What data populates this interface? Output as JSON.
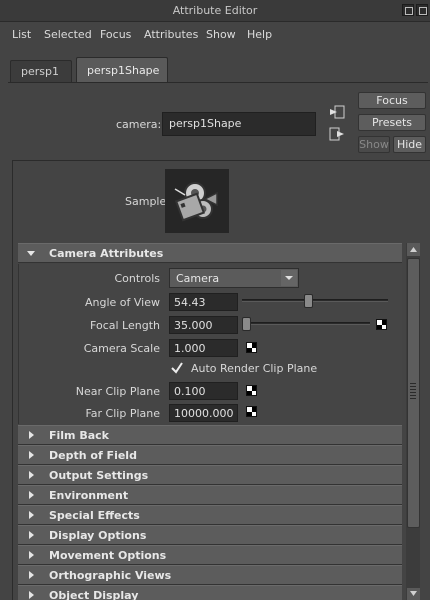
{
  "window": {
    "title": "Attribute Editor"
  },
  "menu": [
    "List",
    "Selected",
    "Focus",
    "Attributes",
    "Show",
    "Help"
  ],
  "tabs": [
    "persp1",
    "persp1Shape"
  ],
  "node": {
    "label": "camera:",
    "value": "persp1Shape"
  },
  "panel_buttons": {
    "focus": "Focus",
    "presets": "Presets",
    "show": "Show",
    "hide": "Hide"
  },
  "sample": {
    "label": "Sample"
  },
  "camera_attributes": {
    "header": "Camera Attributes",
    "controls": {
      "label": "Controls",
      "value": "Camera"
    },
    "angle_of_view": {
      "label": "Angle of View",
      "value": "54.43",
      "slider": 0.45
    },
    "focal_length": {
      "label": "Focal Length",
      "value": "35.000",
      "slider": 0.0
    },
    "camera_scale": {
      "label": "Camera Scale",
      "value": "1.000"
    },
    "auto_render_clip": {
      "label": "Auto Render Clip Plane",
      "checked": true
    },
    "near_clip": {
      "label": "Near Clip Plane",
      "value": "0.100"
    },
    "far_clip": {
      "label": "Far Clip Plane",
      "value": "10000.000"
    }
  },
  "collapsed_sections": [
    "Film Back",
    "Depth of Field",
    "Output Settings",
    "Environment",
    "Special Effects",
    "Display Options",
    "Movement Options",
    "Orthographic Views",
    "Object Display"
  ],
  "icons": {
    "title_buttons": [
      "restore-icon",
      "close-icon"
    ],
    "side": [
      "focus-input-icon",
      "focus-output-icon"
    ],
    "expanded": "triangle-down-icon",
    "collapsed": "triangle-right-icon",
    "map": "checker-map-icon",
    "check": "checkmark-icon"
  }
}
